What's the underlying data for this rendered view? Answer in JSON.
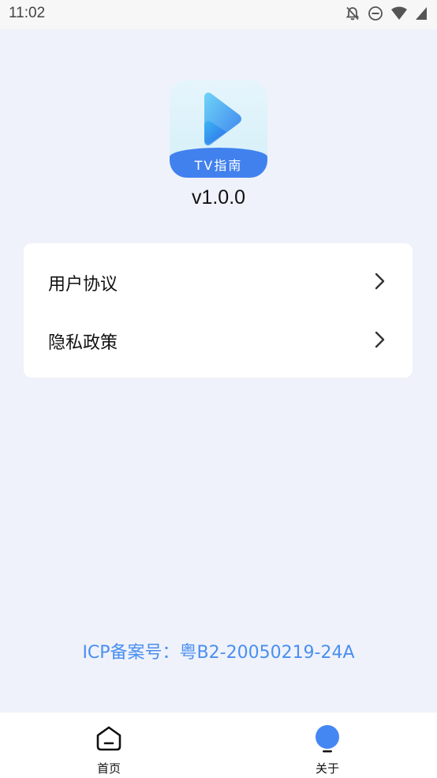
{
  "status_bar": {
    "time": "11:02",
    "icons": [
      "bell-off-icon",
      "do-not-disturb-icon",
      "wifi-icon",
      "signal-icon"
    ]
  },
  "app": {
    "logo_text": "TV指南",
    "version": "v1.0.0"
  },
  "menu": {
    "items": [
      {
        "label": "用户协议"
      },
      {
        "label": "隐私政策"
      }
    ]
  },
  "footer": {
    "icp": "ICP备案号：粤B2-20050219-24A"
  },
  "bottom_nav": {
    "tabs": [
      {
        "label": "首页",
        "icon": "home-icon",
        "active": false
      },
      {
        "label": "关于",
        "icon": "bulb-icon",
        "active": true
      }
    ]
  },
  "colors": {
    "background": "#eff2fa",
    "accent": "#4181ee",
    "icp_text": "#4a8ff0"
  }
}
